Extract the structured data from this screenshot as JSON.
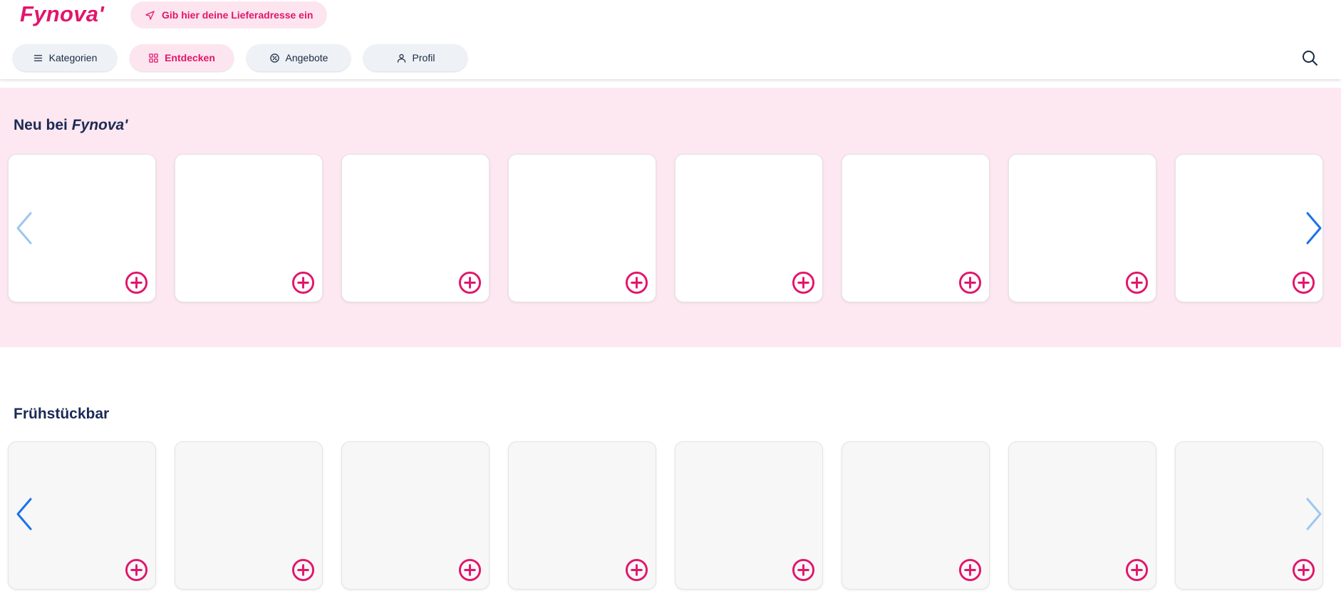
{
  "header": {
    "logo": "Fynova'",
    "address_button": "Gib hier deine Lieferadresse ein",
    "nav": [
      {
        "label": "Kategorien",
        "icon": "menu-icon"
      },
      {
        "label": "Entdecken",
        "icon": "grid-icon",
        "active": true
      },
      {
        "label": "Angebote",
        "icon": "discount-icon"
      },
      {
        "label": "Profil",
        "icon": "user-icon"
      }
    ],
    "search_icon": "search-icon"
  },
  "sections": [
    {
      "title_prefix": "Neu bei",
      "title_brand": "Fynova'",
      "card_count": 8,
      "prev_enabled": false,
      "next_enabled": true
    },
    {
      "title": "Frühstückbar",
      "card_count": 8,
      "prev_enabled": true,
      "next_enabled": false
    }
  ],
  "colors": {
    "brand": "#e2156b",
    "brand_light": "#fde7f0",
    "navy": "#1b2a55",
    "arrow_active": "#1a73e8",
    "arrow_disabled": "#9cc7f0"
  }
}
